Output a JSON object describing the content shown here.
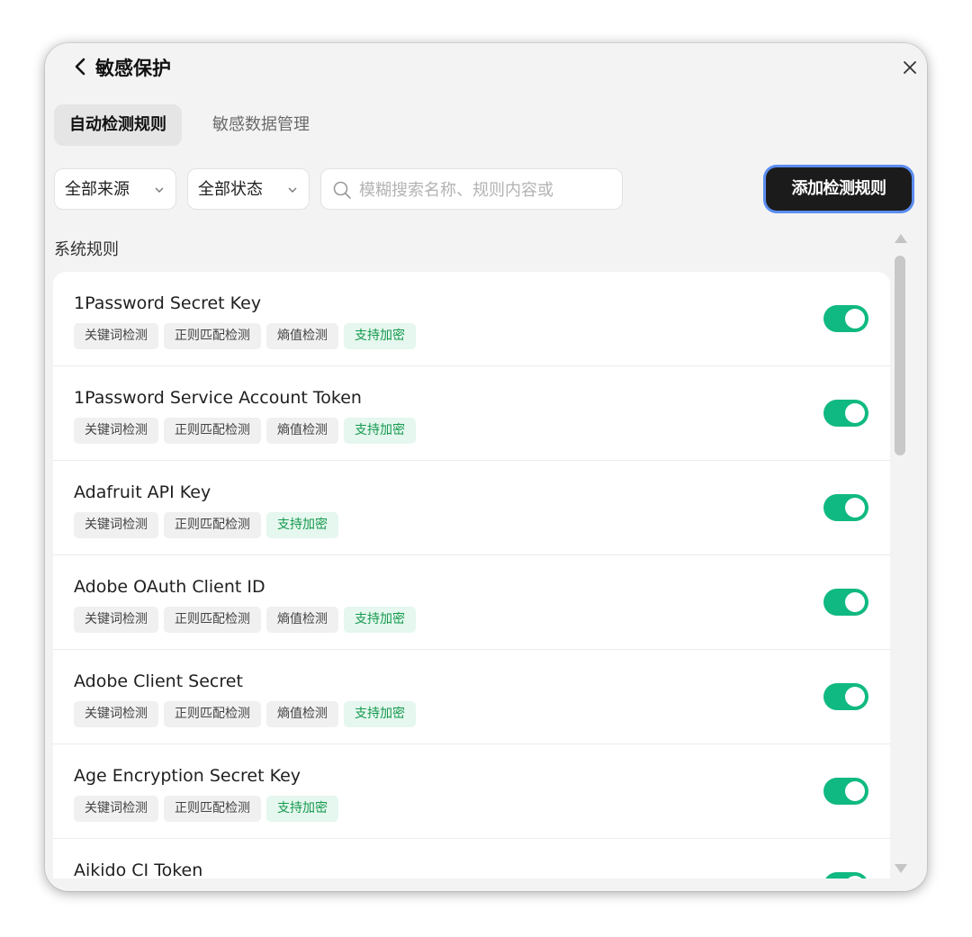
{
  "header": {
    "title": "敏感保护"
  },
  "tabs": [
    {
      "label": "自动检测规则",
      "active": true
    },
    {
      "label": "敏感数据管理",
      "active": false
    }
  ],
  "filters": {
    "source": "全部来源",
    "status": "全部状态",
    "search_placeholder": "模糊搜索名称、规则内容或",
    "add_button": "添加检测规则"
  },
  "section_title": "系统规则",
  "colors": {
    "toggle_on": "#10b981",
    "tag_green_text": "#15994f",
    "tag_green_bg": "#e5f7ee",
    "button_bg": "#1b1b1b",
    "button_ring": "#5b8def"
  },
  "rules": [
    {
      "name": "1Password Secret Key",
      "tags": [
        "关键词检测",
        "正则匹配检测",
        "熵值检测"
      ],
      "encrypt_tag": "支持加密",
      "enabled": true
    },
    {
      "name": "1Password Service Account Token",
      "tags": [
        "关键词检测",
        "正则匹配检测",
        "熵值检测"
      ],
      "encrypt_tag": "支持加密",
      "enabled": true
    },
    {
      "name": "Adafruit API Key",
      "tags": [
        "关键词检测",
        "正则匹配检测"
      ],
      "encrypt_tag": "支持加密",
      "enabled": true
    },
    {
      "name": "Adobe OAuth Client ID",
      "tags": [
        "关键词检测",
        "正则匹配检测",
        "熵值检测"
      ],
      "encrypt_tag": "支持加密",
      "enabled": true
    },
    {
      "name": "Adobe Client Secret",
      "tags": [
        "关键词检测",
        "正则匹配检测",
        "熵值检测"
      ],
      "encrypt_tag": "支持加密",
      "enabled": true
    },
    {
      "name": "Age Encryption Secret Key",
      "tags": [
        "关键词检测",
        "正则匹配检测"
      ],
      "encrypt_tag": "支持加密",
      "enabled": true
    },
    {
      "name": "Aikido CI Token",
      "tags": [],
      "encrypt_tag": "",
      "enabled": true
    }
  ]
}
